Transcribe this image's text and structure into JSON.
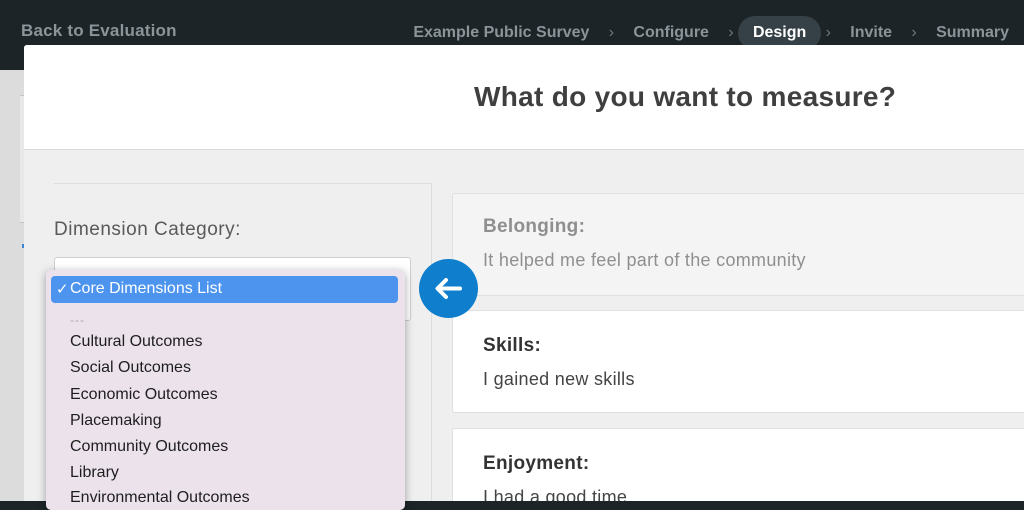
{
  "topbar": {
    "back_label": "Back to Evaluation",
    "steps": [
      {
        "label": "Example Public Survey"
      },
      {
        "label": "Configure"
      },
      {
        "label": "Design"
      },
      {
        "label": "Invite"
      },
      {
        "label": "Summary"
      }
    ],
    "active_step": "Design"
  },
  "modal": {
    "title": "What do you want to measure?",
    "dimension_label": "Dimension Category:"
  },
  "dropdown": {
    "selected": "Core Dimensions List",
    "separator": "---",
    "options": [
      "Cultural Outcomes",
      "Social Outcomes",
      "Economic Outcomes",
      "Placemaking",
      "Community Outcomes",
      "Library",
      "Environmental Outcomes"
    ]
  },
  "cards": [
    {
      "title": "Belonging:",
      "description": "It helped me feel part of the community"
    },
    {
      "title": "Skills:",
      "description": "I gained new skills"
    },
    {
      "title": "Enjoyment:",
      "description": "I had a good time"
    }
  ],
  "colors": {
    "topbar_bg": "#1c2428",
    "active_step_bg": "#354147",
    "highlight": "#4c94ee",
    "arrow_button": "#0f7fcd"
  },
  "icons": {
    "arrow_button": "arrow-left-icon",
    "check": "checkmark-icon"
  }
}
